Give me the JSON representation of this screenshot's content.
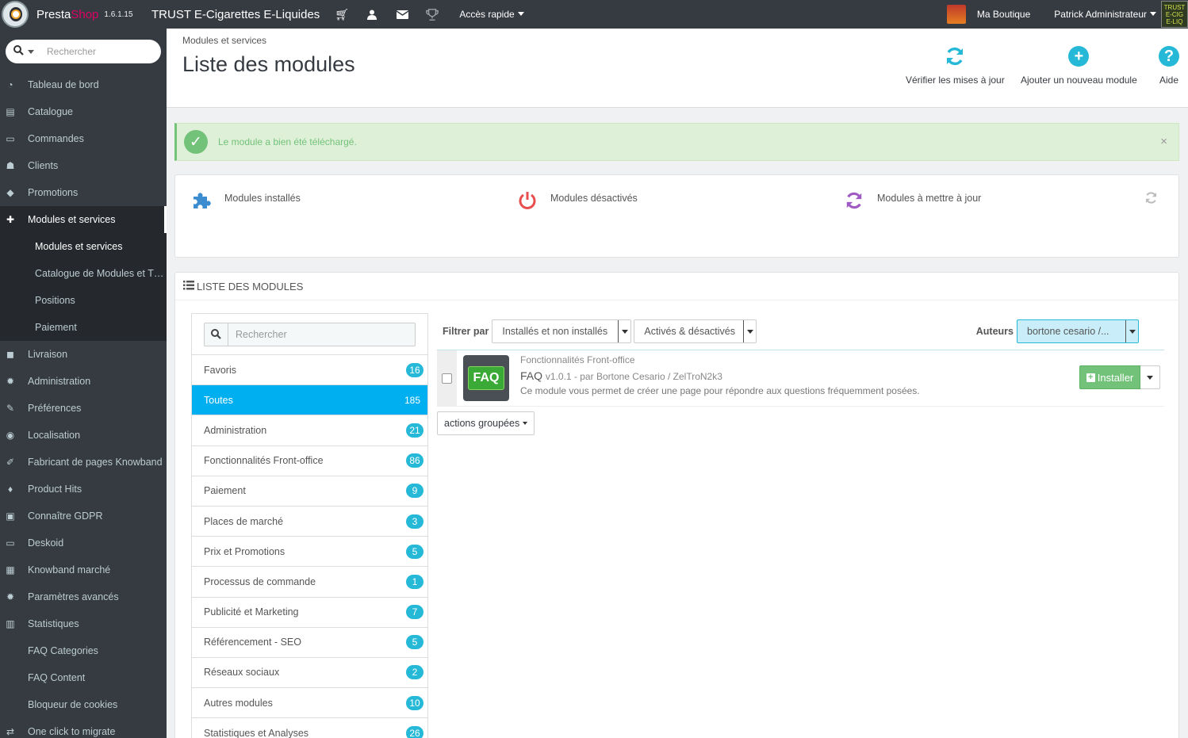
{
  "topbar": {
    "brand_main": "Presta",
    "brand_accent": "Shop",
    "version": "1.6.1.15",
    "shop_name": "TRUST E-Cigarettes E-Liquides",
    "quick_access": "Accès rapide",
    "my_shop": "Ma Boutique",
    "user": "Patrick Administrateur",
    "corner_logo_text": "TRUST E-CIGARETTES E-LIQUIDES"
  },
  "sidebar": {
    "search_placeholder": "Rechercher",
    "items": [
      {
        "label": "Tableau de bord",
        "icon": "dashboard-icon",
        "glyph": "◔"
      },
      {
        "label": "Catalogue",
        "icon": "book-icon",
        "glyph": "▤"
      },
      {
        "label": "Commandes",
        "icon": "credit-card-icon",
        "glyph": "▭"
      },
      {
        "label": "Clients",
        "icon": "users-icon",
        "glyph": "☗"
      },
      {
        "label": "Promotions",
        "icon": "tag-icon",
        "glyph": "◆"
      },
      {
        "label": "Modules et services",
        "icon": "puzzle-icon",
        "glyph": "✚",
        "active": true
      },
      {
        "label": "Livraison",
        "icon": "truck-icon",
        "glyph": "◼"
      },
      {
        "label": "Administration",
        "icon": "cogs-icon",
        "glyph": "✹"
      },
      {
        "label": "Préférences",
        "icon": "wrench-icon",
        "glyph": "✎"
      },
      {
        "label": "Localisation",
        "icon": "globe-icon",
        "glyph": "◉"
      },
      {
        "label": "Fabricant de pages Knowband",
        "icon": "edit-icon",
        "glyph": "✐"
      },
      {
        "label": "Product Hits",
        "icon": "flask-icon",
        "glyph": "♦"
      },
      {
        "label": "Connaître GDPR",
        "icon": "lock-icon",
        "glyph": "▣"
      },
      {
        "label": "Deskoid",
        "icon": "desktop-icon",
        "glyph": "▭"
      },
      {
        "label": "Knowband marché",
        "icon": "archive-icon",
        "glyph": "▦"
      },
      {
        "label": "Paramètres avancés",
        "icon": "cogs-icon",
        "glyph": "✹"
      },
      {
        "label": "Statistiques",
        "icon": "bar-chart-icon",
        "glyph": "▥"
      },
      {
        "label": "FAQ Categories",
        "icon": "",
        "glyph": ""
      },
      {
        "label": "FAQ Content",
        "icon": "",
        "glyph": ""
      },
      {
        "label": "Bloqueur de cookies",
        "icon": "",
        "glyph": ""
      },
      {
        "label": "One click to migrate",
        "icon": "exchange-icon",
        "glyph": "⇄"
      }
    ],
    "subitems": [
      {
        "label": "Modules et services",
        "active": true
      },
      {
        "label": "Catalogue de Modules et T…"
      },
      {
        "label": "Positions"
      },
      {
        "label": "Paiement"
      }
    ]
  },
  "header": {
    "breadcrumb": "Modules et services",
    "title": "Liste des modules",
    "toolbar": {
      "check_updates": "Vérifier les mises à jour",
      "add_module": "Ajouter un nouveau module",
      "help": "Aide"
    }
  },
  "alert": {
    "message": "Le module a bien été téléchargé.",
    "close": "×"
  },
  "stats": {
    "installed": "Modules installés",
    "disabled": "Modules désactivés",
    "to_update": "Modules à mettre à jour"
  },
  "list": {
    "heading": "LISTE DES MODULES",
    "search_placeholder": "Rechercher",
    "categories": [
      {
        "label": "Favoris",
        "count": "16"
      },
      {
        "label": "Toutes",
        "count": "185",
        "active": true
      },
      {
        "label": "Administration",
        "count": "21"
      },
      {
        "label": "Fonctionnalités Front-office",
        "count": "86"
      },
      {
        "label": "Paiement",
        "count": "9"
      },
      {
        "label": "Places de marché",
        "count": "3"
      },
      {
        "label": "Prix et Promotions",
        "count": "5"
      },
      {
        "label": "Processus de commande",
        "count": "1"
      },
      {
        "label": "Publicité et Marketing",
        "count": "7"
      },
      {
        "label": "Référencement - SEO",
        "count": "5"
      },
      {
        "label": "Réseaux sociaux",
        "count": "2"
      },
      {
        "label": "Autres modules",
        "count": "10"
      },
      {
        "label": "Statistiques et Analyses",
        "count": "26"
      }
    ],
    "filters": {
      "label": "Filtrer par",
      "install_state": "Installés et non installés",
      "active_state": "Activés & désactivés",
      "authors_label": "Auteurs",
      "authors_value": "bortone cesario /..."
    },
    "module": {
      "category": "Fonctionnalités Front-office",
      "logo_text": "FAQ",
      "name": "FAQ",
      "version": "v1.0.1 - par Bortone Cesario / ZelTroN2k3",
      "description": "Ce module vous permet de créer une page pour répondre aux questions fréquemment posées.",
      "install": "Installer"
    },
    "bulk_actions": "actions groupées"
  },
  "colors": {
    "accent": "#25b9d7",
    "success": "#72c279",
    "brand_pink": "#df0067",
    "sidebar_bg": "#363a41",
    "disabled_red": "#e84e4e",
    "update_purple": "#a05ac3",
    "installed_blue": "#3b8dd0"
  }
}
